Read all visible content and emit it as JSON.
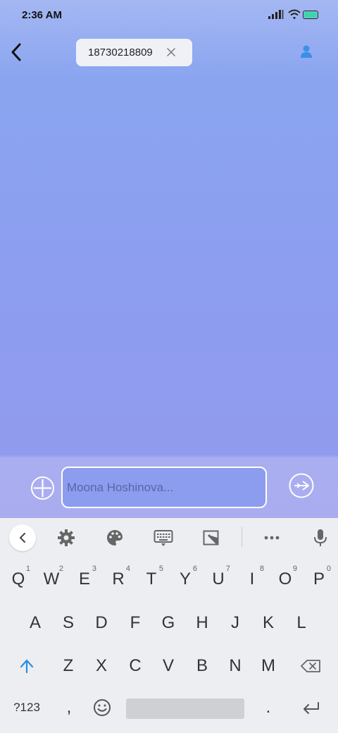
{
  "status_bar": {
    "time": "2:36 AM"
  },
  "header": {
    "recipient_chip": "18730218809"
  },
  "composer": {
    "placeholder": "Moona Hoshinova..."
  },
  "keyboard": {
    "row1": [
      {
        "label": "Q",
        "hint": "1"
      },
      {
        "label": "W",
        "hint": "2"
      },
      {
        "label": "E",
        "hint": "3"
      },
      {
        "label": "R",
        "hint": "4"
      },
      {
        "label": "T",
        "hint": "5"
      },
      {
        "label": "Y",
        "hint": "6"
      },
      {
        "label": "U",
        "hint": "7"
      },
      {
        "label": "I",
        "hint": "8"
      },
      {
        "label": "O",
        "hint": "9"
      },
      {
        "label": "P",
        "hint": "0"
      }
    ],
    "row2": [
      "A",
      "S",
      "D",
      "F",
      "G",
      "H",
      "J",
      "K",
      "L"
    ],
    "row3": [
      "Z",
      "X",
      "C",
      "V",
      "B",
      "N",
      "M"
    ],
    "bottom": {
      "symbols": "?123",
      "comma": ",",
      "period": "."
    },
    "accent_color": "#2a8fe0"
  }
}
